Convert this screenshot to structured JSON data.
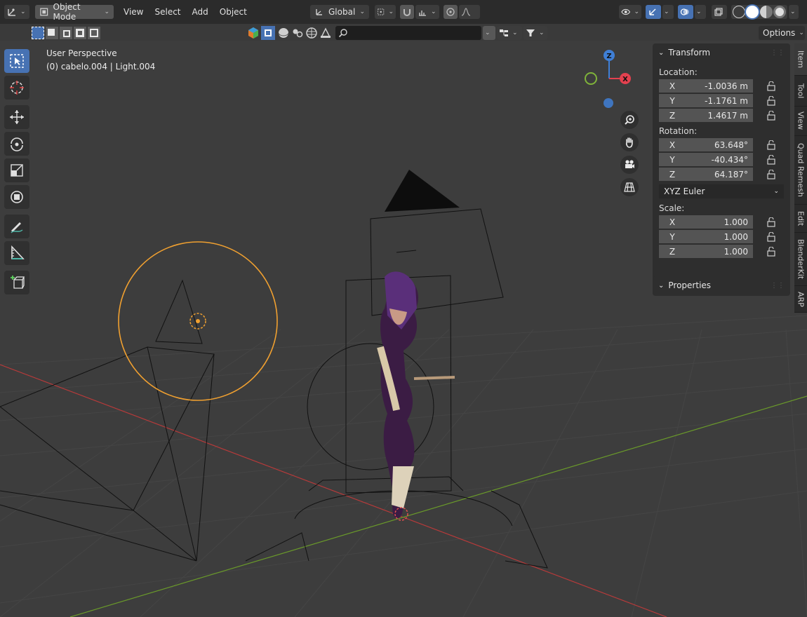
{
  "header": {
    "mode_label": "Object Mode",
    "menus": [
      "View",
      "Select",
      "Add",
      "Object"
    ],
    "orientation_label": "Global",
    "options_label": "Options"
  },
  "viewport": {
    "view_name": "User Perspective",
    "selection_info": "(0) cabelo.004 | Light.004"
  },
  "gizmo": {
    "z_label": "Z",
    "x_label": "X",
    "x_color": "#e4414f",
    "y_color": "#7fb33a",
    "z_color": "#3f7fd6"
  },
  "search": {
    "placeholder": ""
  },
  "npanel": {
    "transform_title": "Transform",
    "location_label": "Location:",
    "location": [
      {
        "axis": "X",
        "value": "-1.0036 m"
      },
      {
        "axis": "Y",
        "value": "-1.1761 m"
      },
      {
        "axis": "Z",
        "value": "1.4617 m"
      }
    ],
    "rotation_label": "Rotation:",
    "rotation": [
      {
        "axis": "X",
        "value": "63.648°"
      },
      {
        "axis": "Y",
        "value": "-40.434°"
      },
      {
        "axis": "Z",
        "value": "64.187°"
      }
    ],
    "rotation_mode": "XYZ Euler",
    "scale_label": "Scale:",
    "scale": [
      {
        "axis": "X",
        "value": "1.000"
      },
      {
        "axis": "Y",
        "value": "1.000"
      },
      {
        "axis": "Z",
        "value": "1.000"
      }
    ],
    "properties_title": "Properties"
  },
  "side_tabs": [
    "Item",
    "Tool",
    "View",
    "Quad Remesh",
    "Edit",
    "BlenderKit",
    "ARP"
  ],
  "colors": {
    "accent": "#4772b3",
    "selected_outline": "#f0a030",
    "x_axis_line": "#b83a3a",
    "y_axis_line": "#6a9a2a"
  }
}
